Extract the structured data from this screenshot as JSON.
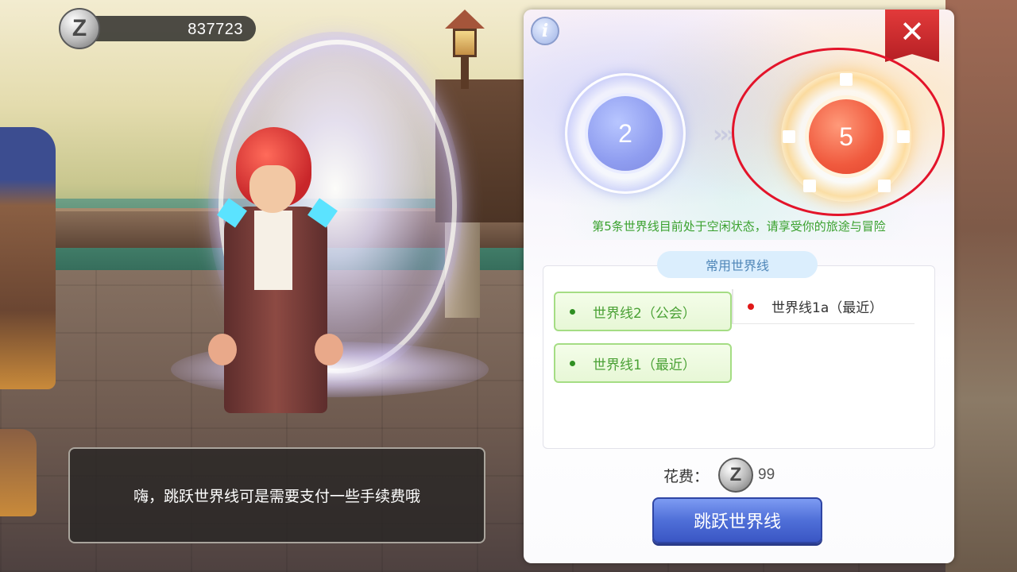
{
  "hud": {
    "currency_icon": "zeny-coin-icon",
    "currency_glyph": "Z",
    "currency_amount": "837723"
  },
  "dialog": {
    "text": "嗨，跳跃世界线可是需要支付一些手续费哦"
  },
  "panel": {
    "info_glyph": "i",
    "close_glyph": "✕",
    "current_line": "2",
    "transfer_arrows": "›››",
    "target_line": "5",
    "status_text": "第5条世界线目前处于空闲状态，请享受你的旅途与冒险",
    "common_tab_label": "常用世界线",
    "lines": [
      {
        "label": "世界线2（公会）"
      },
      {
        "label": "世界线1（最近）"
      }
    ],
    "recent_line": "世界线1a（最近）",
    "cost_label": "花费：",
    "cost_glyph": "Z",
    "cost_amount": "99",
    "jump_button_label": "跳跃世界线"
  },
  "colors": {
    "status_green": "#3aa12e",
    "highlight_red": "#e3142a",
    "jump_button_blue": "#4f6fd8",
    "target_orb": "#f05a3e",
    "current_orb": "#8f9df0"
  }
}
